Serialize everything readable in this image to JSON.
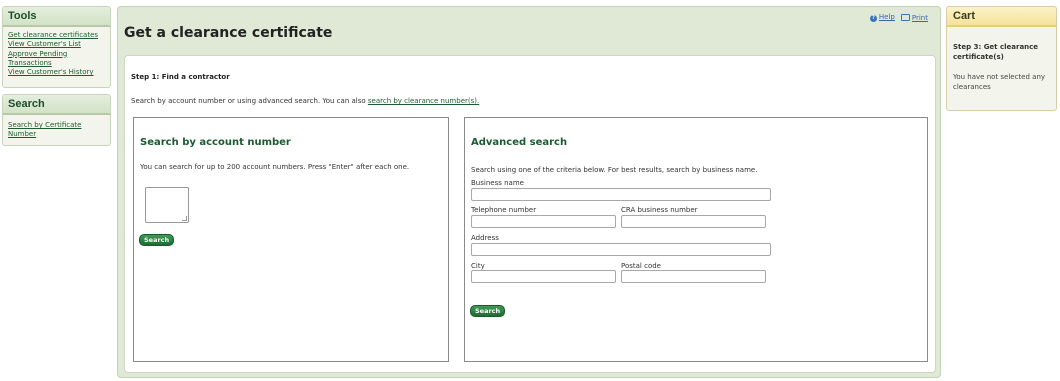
{
  "tools": {
    "title": "Tools",
    "links": [
      "Get clearance certificates",
      "View Customer's List",
      "Approve Pending",
      "Transactions",
      "View Customer's History"
    ]
  },
  "search_panel": {
    "title": "Search",
    "links": [
      "Search by Certificate",
      "Number"
    ]
  },
  "main": {
    "title": "Get a clearance certificate",
    "help_label": "Help",
    "print_label": "Print",
    "step_title": "Step 1: Find a contractor",
    "intro_text": "Search by account number or using advanced search. You can also",
    "intro_link": "search by clearance number(s)."
  },
  "account_search": {
    "title": "Search by account number",
    "description": "You can search for up to 200 account numbers. Press \"Enter\" after each one.",
    "textarea_value": "",
    "button_label": "Search"
  },
  "advanced_search": {
    "title": "Advanced search",
    "description": "Search using one of the criteria below. For best results, search by business name.",
    "fields": {
      "business_name": {
        "label": "Business name",
        "value": ""
      },
      "telephone": {
        "label": "Telephone number",
        "value": ""
      },
      "cra_number": {
        "label": "CRA business number",
        "value": ""
      },
      "address": {
        "label": "Address",
        "value": ""
      },
      "city": {
        "label": "City",
        "value": ""
      },
      "postal_code": {
        "label": "Postal code",
        "value": ""
      }
    },
    "button_label": "Search"
  },
  "cart": {
    "title": "Cart",
    "step_text": "Step 3: Get clearance certificate(s)",
    "empty_text": "You have not selected any clearances"
  },
  "colors": {
    "accent_green": "#1b5a31",
    "button_green": "#2e8045",
    "panel_bg": "#dfe9d5",
    "cart_header": "#f5e39a"
  },
  "icons": [
    "help-icon",
    "print-icon",
    "textarea-resize-grip-icon"
  ]
}
